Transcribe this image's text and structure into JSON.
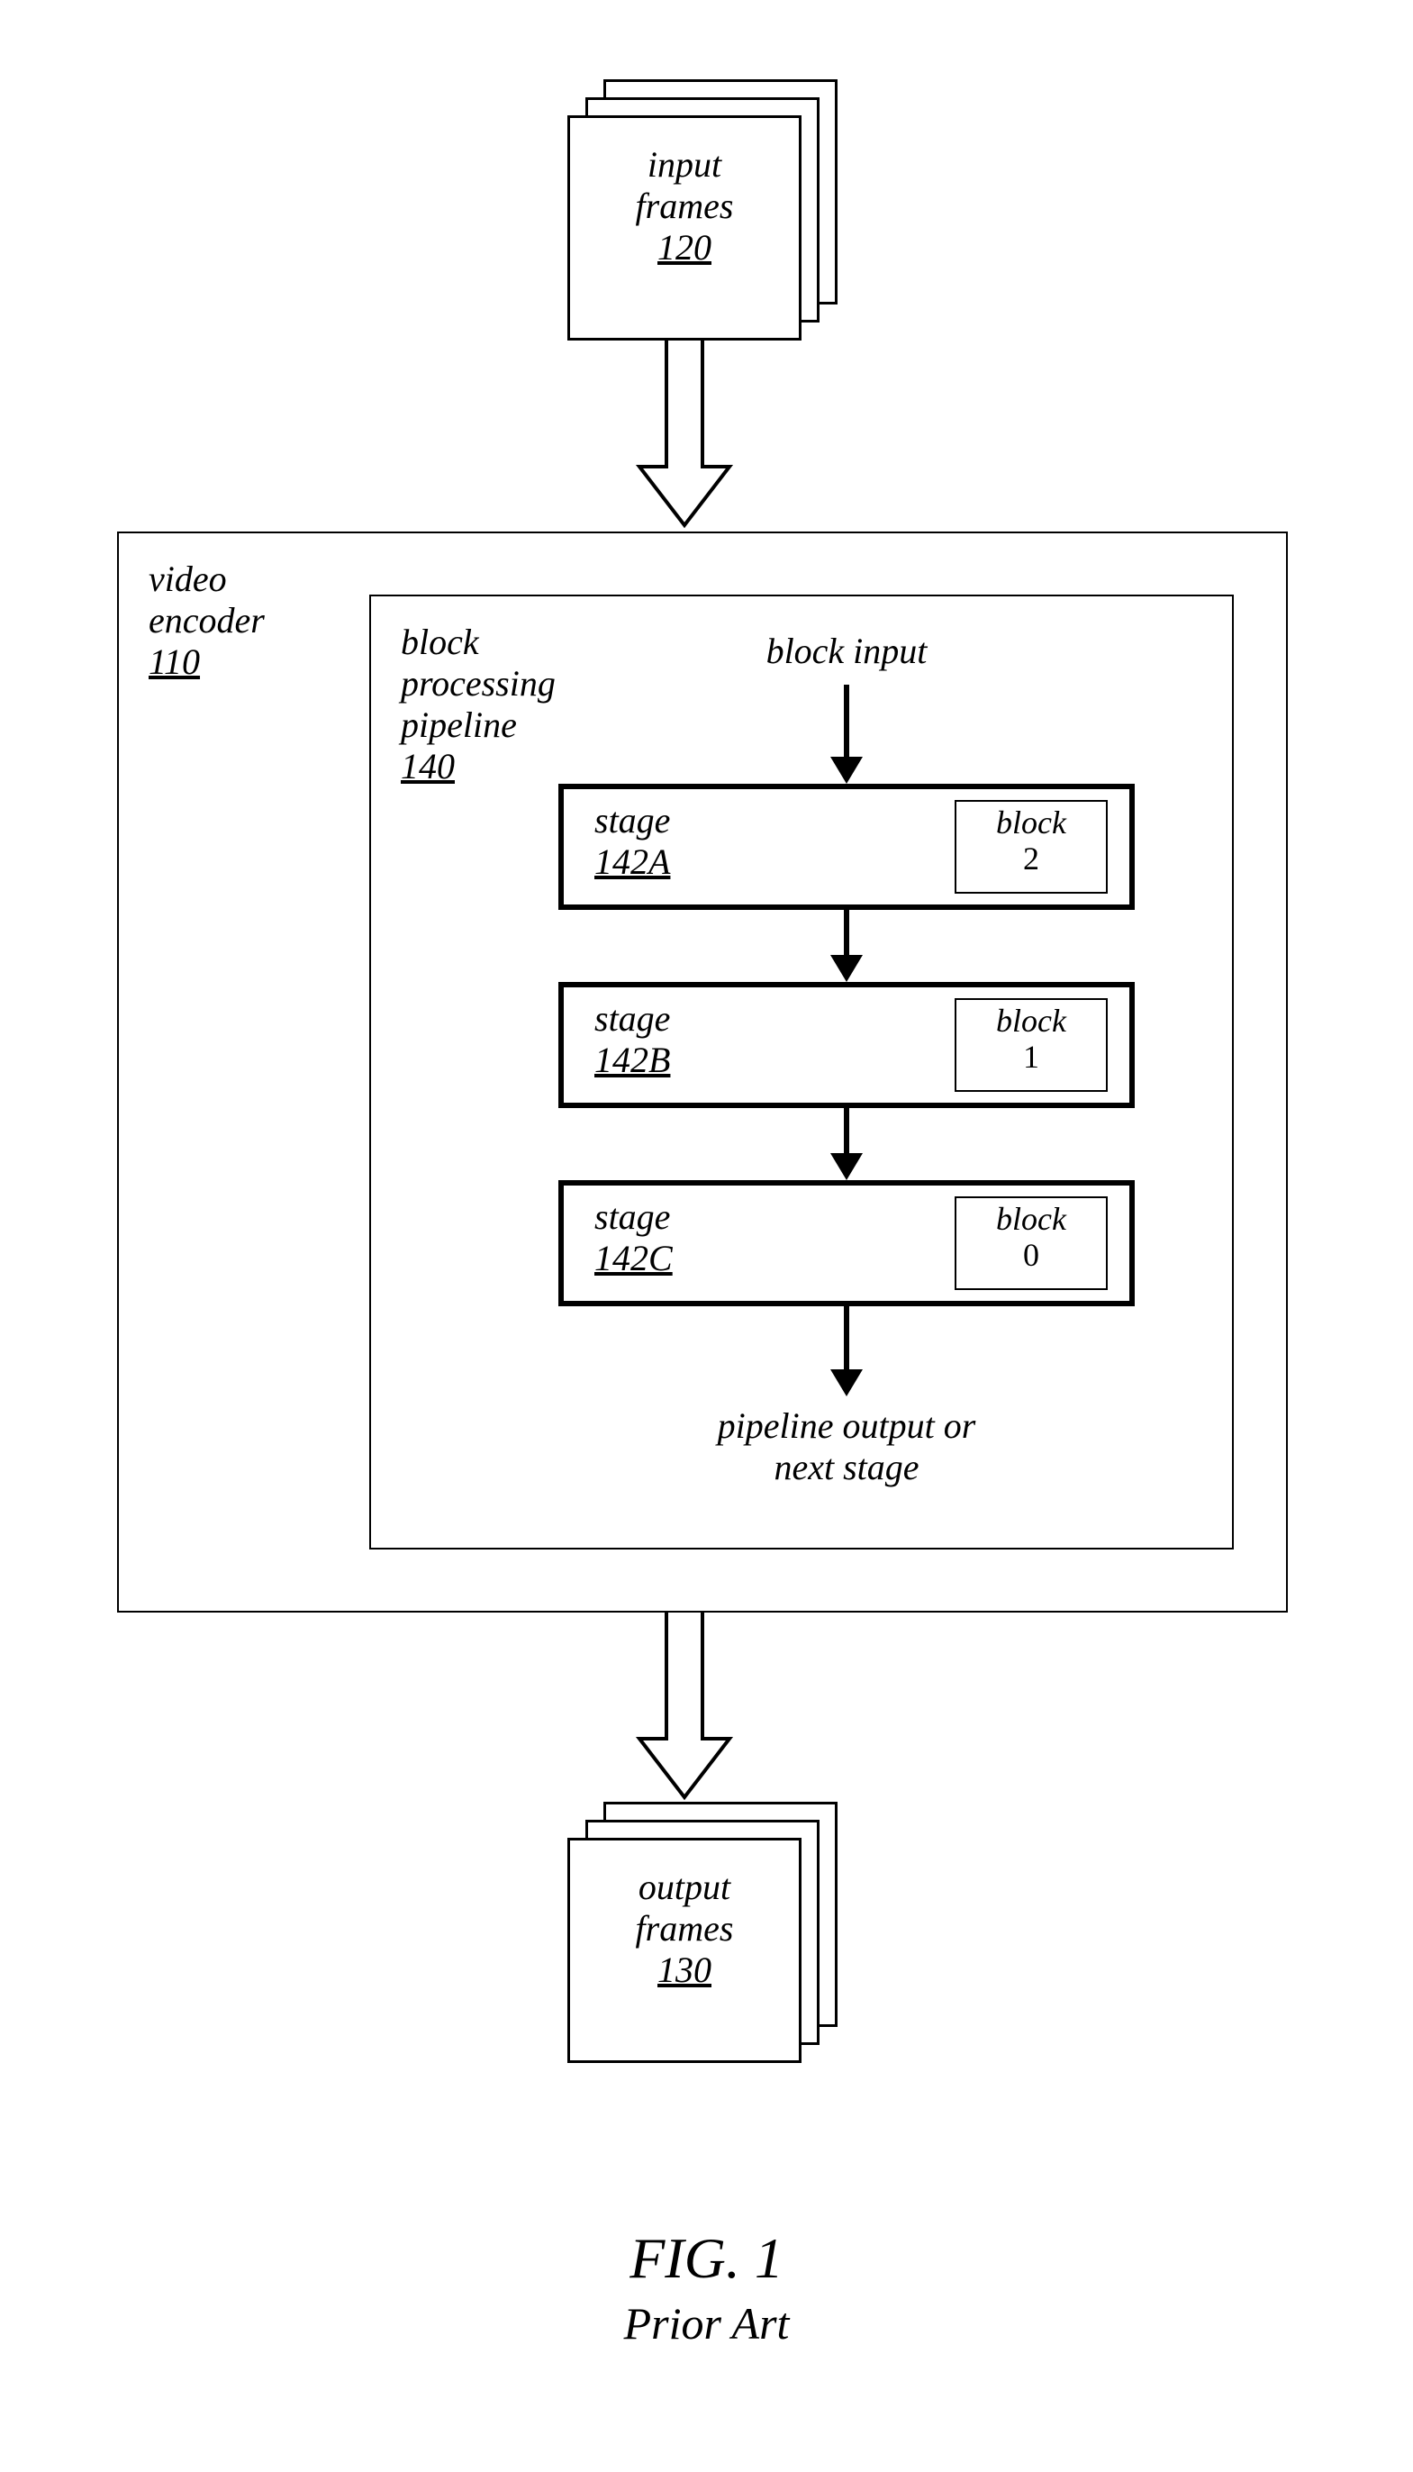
{
  "input_frames": {
    "line1": "input",
    "line2": "frames",
    "num": "120"
  },
  "output_frames": {
    "line1": "output",
    "line2": "frames",
    "num": "130"
  },
  "video_encoder": {
    "line1": "video",
    "line2": "encoder",
    "num": "110"
  },
  "pipeline": {
    "line1": "block",
    "line2": "processing",
    "line3": "pipeline",
    "num": "140"
  },
  "block_input": "block input",
  "stages": {
    "a": {
      "label": "stage",
      "num": "142A",
      "block_label": "block",
      "block_num": "2"
    },
    "b": {
      "label": "stage",
      "num": "142B",
      "block_label": "block",
      "block_num": "1"
    },
    "c": {
      "label": "stage",
      "num": "142C",
      "block_label": "block",
      "block_num": "0"
    }
  },
  "pipeline_output": {
    "line1": "pipeline output or",
    "line2": "next stage"
  },
  "figure": {
    "title": "FIG. 1",
    "subtitle": "Prior Art"
  }
}
